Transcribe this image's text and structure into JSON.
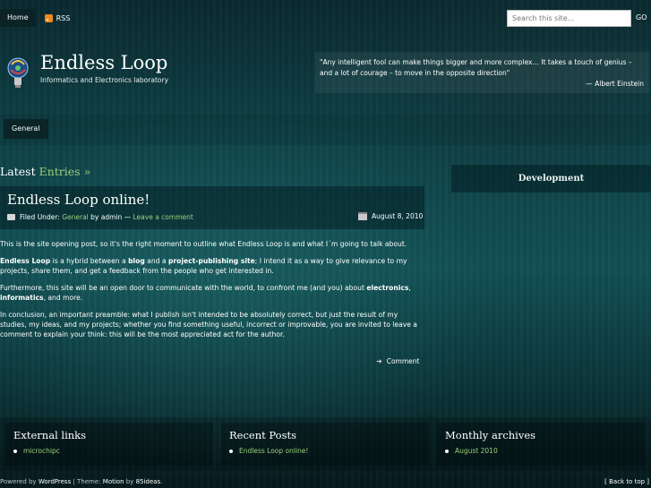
{
  "nav": {
    "home": "Home",
    "rss": "RSS"
  },
  "search": {
    "placeholder": "Search this site...",
    "go": "GO"
  },
  "header": {
    "title": "Endless Loop",
    "tagline": "Informatics and Electronics laboratory",
    "quote": "\"Any intelligent fool can make things bigger and more complex… It takes a touch of genius – and a lot of courage – to move in the opposite direction\"",
    "quote_author": "— Albert Einstein"
  },
  "categories": {
    "general": "General"
  },
  "main": {
    "heading_prefix": "Latest",
    "heading_accent": "Entries »"
  },
  "post": {
    "title": "Endless Loop online!",
    "filed_under": "Filed Under:",
    "category": "General",
    "by": "by admin —",
    "leave_comment": "Leave a comment",
    "date": "August 8, 2010",
    "p1": "This is the site opening post, so it's the right moment to outline what Endless Loop is and what I´m going to talk about.",
    "p2_b1": "Endless Loop",
    "p2_t1": " is a hybrid between a ",
    "p2_b2": "blog",
    "p2_t2": " and a ",
    "p2_b3": "project-publishing site",
    "p2_t3": "; I intend it as a way to give relevance to my projects, share them, and get a feedback from the people who get interested in.",
    "p3_t1": "Furthermore, this site will be an open door to communicate with the world, to confront me (and you) about ",
    "p3_b1": "electronics",
    "p3_t2": ", ",
    "p3_b2": "informatics",
    "p3_t3": ", and more.",
    "p4": "In conclusion, an important preamble: what I publish isn't intended to be absolutely correct, but just the result of my studies, my ideas, and my projects; whether you find something useful, incorrect or improvable, you are invited to leave a comment to explain your think: this will be the most appreciated act for the author.",
    "comment": "Comment"
  },
  "sidebar": {
    "title": "Development"
  },
  "footer_widgets": [
    {
      "title": "External links",
      "item": "microchipc"
    },
    {
      "title": "Recent Posts",
      "item": "Endless Loop online!"
    },
    {
      "title": "Monthly archives",
      "item": "August 2010"
    }
  ],
  "footer": {
    "powered": "Powered by",
    "wordpress": "WordPress",
    "theme_sep": " | Theme: ",
    "motion": "Motion",
    "by": " by ",
    "ideas": "85ideas",
    "dot": ".",
    "back_to_top": "[ Back to top ]"
  },
  "colors": {
    "accent": "#9ad07a",
    "rss": "#f08a1d",
    "background": "#0f4348"
  }
}
